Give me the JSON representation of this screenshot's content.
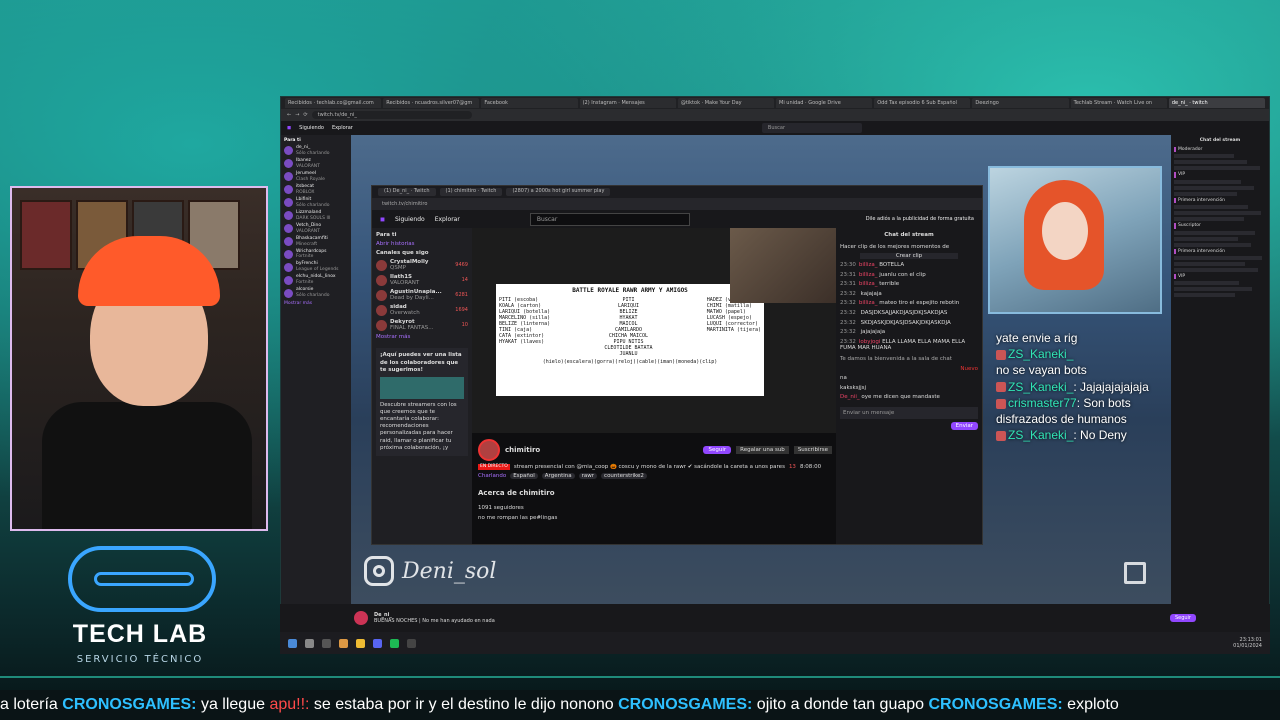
{
  "browser": {
    "tabs": [
      "Recibidos · techlab.co@gmail.com",
      "Recibidos · ncuadros.silver07@gm",
      "Facebook",
      "(2) Instagram · Mensajes",
      "@tiktok · Make Your Day",
      "Mi unidad · Google Drive",
      "Odd Tax episodio 6 Sub Español",
      "Deezingo",
      "Techlab Stream · Watch Live on",
      "de_ni_ · twitch"
    ],
    "url": "twitch.tv/de_ni_",
    "nav": {
      "following": "Siguiendo",
      "browse": "Explorar",
      "search_placeholder": "Buscar"
    },
    "sidebar": {
      "header": "Para ti",
      "channels": [
        {
          "name": "de_ni_",
          "game": "Sólo charlando"
        },
        {
          "name": "Ibanez",
          "game": "VALORANT"
        },
        {
          "name": "Jerumeel",
          "game": "Clash Royale"
        },
        {
          "name": "itsbecat",
          "game": "ROBLOX"
        },
        {
          "name": "Lbifinit",
          "game": "Sólo charlando"
        },
        {
          "name": "Lizzmaland",
          "game": "DARK SOULS III"
        },
        {
          "name": "Vetch_Dino",
          "game": "VALORANT"
        },
        {
          "name": "Bhaskacamfiti",
          "game": "Minecraft"
        },
        {
          "name": "Wrichardcops",
          "game": "Fortnite"
        },
        {
          "name": "byFrenchi",
          "game": "League of Legends"
        },
        {
          "name": "elchu_nidoL_linox",
          "game": "Fortnite"
        },
        {
          "name": "alcorsie",
          "game": "Sólo charlando"
        }
      ],
      "show_more": "Mostrar más"
    },
    "chat_header": "Chat del stream",
    "right_chat": [
      "Moderador",
      "VIP",
      "Primera intervención",
      "Suscriptor",
      "Primera intervención",
      "VIP"
    ]
  },
  "inner": {
    "tabs": [
      "(1) De_ni_ · Twitch",
      "(1) chimitiro · Twitch",
      "(2807) a 2000s hot girl summer play"
    ],
    "url": "twitch.tv/chimitiro",
    "nav": {
      "following": "Siguiendo",
      "browse": "Explorar",
      "search_placeholder": "Buscar"
    },
    "ad_text": "Dile adiós a la publicidad de forma gratuita",
    "sidebar": {
      "header": "Para ti",
      "open_history": "Abrir historias",
      "following_label": "Canales que sigo",
      "channels": [
        {
          "name": "CrystalMolly",
          "game": "QSMP",
          "count": "9469"
        },
        {
          "name": "Ilath1S",
          "game": "VALORANT",
          "count": "14"
        },
        {
          "name": "AgustinUnapia...",
          "game": "Dead by Dayli...",
          "count": "6281"
        },
        {
          "name": "sidad",
          "game": "Overwatch",
          "count": "1694"
        },
        {
          "name": "Dekyrot",
          "game": "FINAL FANTAS...",
          "count": "10"
        }
      ],
      "show_more": "Mostrar más",
      "promo_title": "¡Aquí puedes ver una lista de los colaboradores que te sugerimos!",
      "promo_body": "Descubre streamers con los que creemos que te encantaría colaborar: recomendaciones personalizadas para hacer raid, llamar o planificar tu próxima colaboración, ¡y"
    },
    "whiteboard": {
      "title": "BATTLE ROYALE RAWR ARMY Y AMIGOS",
      "left": [
        "PITI (escoba)",
        "KOALA (carton)",
        "LARIQUI (botella)",
        "MARCELINO (silla)",
        "BELIZE (linterna)",
        "TINI (caja)",
        "CATA (extintor)",
        "HYAKAT (llaves)"
      ],
      "mid": [
        "PITI",
        "LARIQUI",
        "BELIZE",
        "HYAKAT",
        "MAICOL",
        "CAMILARDO",
        "CHICHA MAICOL",
        "PIPU NITIS",
        "CLEOTILDE BATATA",
        "JUANLU"
      ],
      "right": [
        "HADEZ (ventana)",
        "CHIMI (matilla)",
        "MATWO (papel)",
        "LUCASH (espejo)",
        "LUQUI (corrector)",
        "MARTINITA (tijera)"
      ],
      "bottom": [
        "(hielo)(escalera)(gorra)(reloj)(cable)(iman)(moneda)(clip)"
      ]
    },
    "streamer": "chimitiro",
    "follow_btn": "Seguir",
    "gift_btn": "Regalar una sub",
    "sub_btn": "Suscribirse",
    "live_badge": "EN DIRECTO",
    "stream_title": "stream presencial con @mia_coop 🎃 coscu y mono de la rawr ✔ sacándole la careta a unos pares",
    "category": "Charlando",
    "tags": [
      "Español",
      "Argentina",
      "rawr",
      "counterstrike2"
    ],
    "viewers": "13",
    "uptime": "8:08:00",
    "about_title": "Acerca de chimitiro",
    "followers": "1091 seguidores",
    "bio": "no me rompan las pe#lingas",
    "chat": {
      "header": "Chat del stream",
      "pinned": "Hacer clip de los mejores momentos de",
      "clip_btn": "Crear clip",
      "lines": [
        {
          "ts": "23:30",
          "user": "billiza_",
          "text": "BOTELLA"
        },
        {
          "ts": "23:31",
          "user": "billiza_",
          "text": "juanlu con el clip"
        },
        {
          "ts": "23:31",
          "user": "billiza_",
          "text": "terrible"
        },
        {
          "ts": "23:32",
          "user": "",
          "text": "kajajaja"
        },
        {
          "ts": "23:32",
          "user": "billiza_",
          "text": "mateo tiro el espejito rebotin"
        },
        {
          "ts": "23:32",
          "user": "",
          "text": "DASJDKSAJJAKDJASJDKJSAKDJAS"
        },
        {
          "ts": "23:32",
          "user": "",
          "text": "SKDJASKJDKJASJDSAKJDKJASKDJA"
        },
        {
          "ts": "23:32",
          "user": "",
          "text": "jajajajaja"
        },
        {
          "ts": "23:32",
          "user": "lobyjogi",
          "text": "ELLA LLAMA ELLA MAMA ELLA FUMA MAR HUANA"
        }
      ],
      "welcome": "Te damos la bienvenida a la sala de chat",
      "new_label": "Nuevo",
      "lines2": [
        {
          "user": "",
          "text": "na"
        },
        {
          "user": "",
          "text": "kaksksjjsj"
        },
        {
          "user": "De_nii_",
          "text": "oye me dicen que mandaste"
        }
      ],
      "input_placeholder": "Enviar un mensaje",
      "send_btn": "Enviar"
    }
  },
  "overlay_chat": [
    {
      "user": "",
      "text": "yate envie a rig"
    },
    {
      "user": "ZS_Kaneki_",
      "text": ""
    },
    {
      "user": "",
      "text": "no se vayan bots"
    },
    {
      "user": "ZS_Kaneki_",
      "text": "Jajajajajajaja"
    },
    {
      "user": "crismaster77",
      "text": "Son bots disfrazados de humanos"
    },
    {
      "user": "ZS_Kaneki_",
      "text": "No Deny"
    }
  ],
  "watermark": {
    "handle": "Deni_sol"
  },
  "bottom_strip": {
    "name": "De_ni_",
    "status": "BUENAS NOCHES | No me han ayudado en nada",
    "followers_btn": "Seguir"
  },
  "taskbar": {
    "time": "23:13:01",
    "date": "01/01/2024"
  },
  "logo": {
    "line1": "TECH LAB",
    "sub": "SERVICIO TÉCNICO"
  },
  "ticker": [
    {
      "type": "text",
      "value": "a lotería "
    },
    {
      "type": "user",
      "value": "CRONOSGAMES:"
    },
    {
      "type": "text",
      "value": " ya llegue "
    },
    {
      "type": "red",
      "value": "apu!!:"
    },
    {
      "type": "text",
      "value": " se estaba por ir y el destino le dijo nonono "
    },
    {
      "type": "user",
      "value": "CRONOSGAMES:"
    },
    {
      "type": "text",
      "value": " ojito a donde tan guapo "
    },
    {
      "type": "user",
      "value": "CRONOSGAMES:"
    },
    {
      "type": "text",
      "value": " exploto"
    }
  ],
  "colors": {
    "accent": "#9147ff",
    "teal": "#2bbfae",
    "ticker_user": "#2ec0ff"
  }
}
